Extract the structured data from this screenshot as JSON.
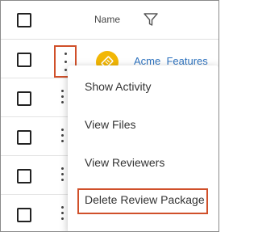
{
  "table": {
    "header": {
      "name_label": "Name"
    },
    "rows": [
      {
        "link": "Acme_Features"
      },
      {
        "link": ""
      },
      {
        "link": ""
      },
      {
        "link": ""
      },
      {
        "link": ""
      }
    ]
  },
  "menu": {
    "items": [
      {
        "label": "Show Activity"
      },
      {
        "label": "View Files"
      },
      {
        "label": "View Reviewers"
      },
      {
        "label": "Delete Review Package"
      }
    ]
  },
  "colors": {
    "highlight": "#d0502a",
    "link": "#2f74c0",
    "file_icon": "#f2b705"
  }
}
